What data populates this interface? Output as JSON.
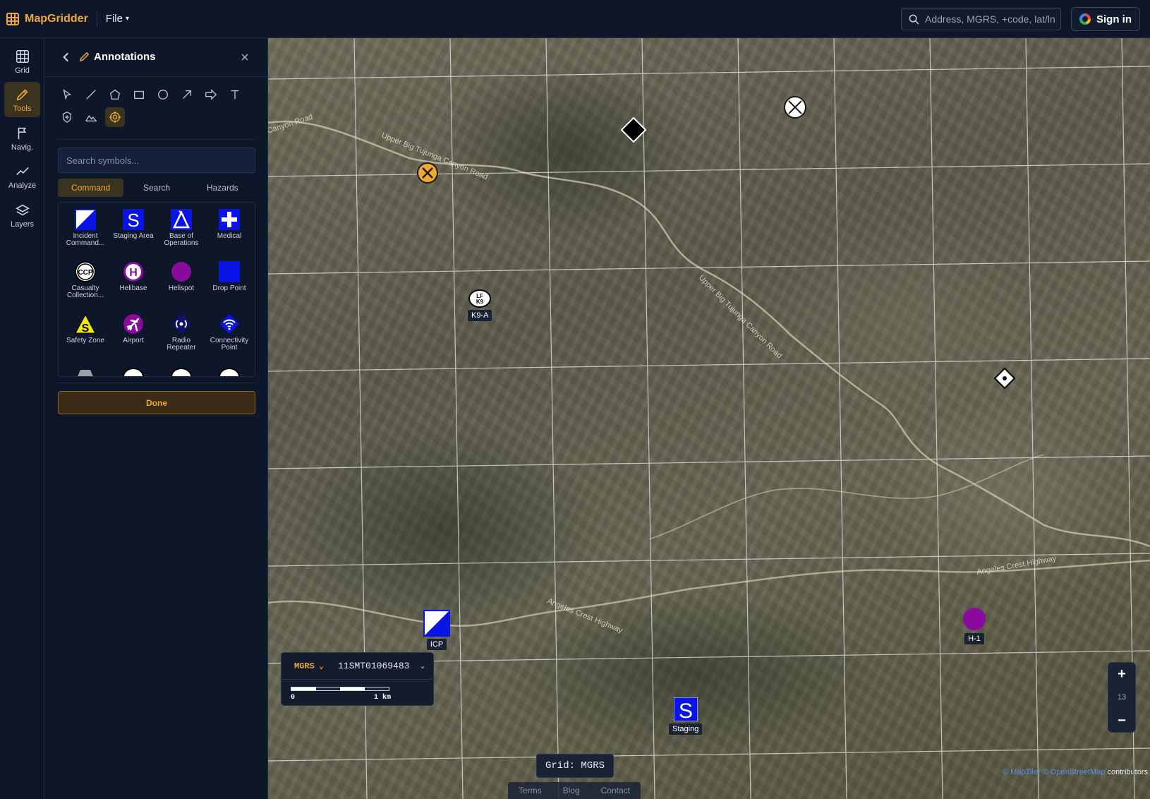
{
  "app": {
    "name": "MapGridder"
  },
  "menu": {
    "file_label": "File"
  },
  "search": {
    "placeholder": "Address, MGRS, +code, lat/ln"
  },
  "auth": {
    "signin_label": "Sign in"
  },
  "rail": {
    "items": [
      {
        "label": "Grid",
        "icon": "grid-icon",
        "active": false
      },
      {
        "label": "Tools",
        "icon": "pencil-icon",
        "active": true
      },
      {
        "label": "Navig.",
        "icon": "flag-icon",
        "active": false
      },
      {
        "label": "Analyze",
        "icon": "chart-line-icon",
        "active": false
      },
      {
        "label": "Layers",
        "icon": "layers-icon",
        "active": false
      }
    ]
  },
  "panel": {
    "title": "Annotations",
    "tools": [
      "select-icon",
      "line-icon",
      "polygon-icon",
      "rectangle-icon",
      "circle-icon",
      "arrow-icon",
      "big-arrow-icon",
      "text-icon",
      "shield-plus-icon",
      "terrain-icon",
      "symbol-target-icon"
    ],
    "active_tool": "symbol-target-icon",
    "symbol_search_placeholder": "Search symbols...",
    "categories": [
      {
        "label": "Command",
        "active": true
      },
      {
        "label": "Search",
        "active": false
      },
      {
        "label": "Hazards",
        "active": false
      }
    ],
    "symbols": [
      {
        "label": "Incident Command...",
        "icon": "incident-command-icon"
      },
      {
        "label": "Staging Area",
        "icon": "staging-area-icon"
      },
      {
        "label": "Base of Operations",
        "icon": "base-of-operations-icon"
      },
      {
        "label": "Medical",
        "icon": "medical-cross-icon"
      },
      {
        "label": "Casualty Collection...",
        "icon": "ccp-icon"
      },
      {
        "label": "Helibase",
        "icon": "helibase-icon"
      },
      {
        "label": "Helispot",
        "icon": "helispot-icon"
      },
      {
        "label": "Drop Point",
        "icon": "drop-point-icon"
      },
      {
        "label": "Safety Zone",
        "icon": "safety-zone-icon"
      },
      {
        "label": "Airport",
        "icon": "airport-icon"
      },
      {
        "label": "Radio Repeater",
        "icon": "radio-repeater-icon"
      },
      {
        "label": "Connectivity Point",
        "icon": "connectivity-icon"
      }
    ],
    "done_label": "Done"
  },
  "map": {
    "markers": {
      "k9": {
        "label": "K9-A",
        "icon_text": "LF K9"
      },
      "icp": {
        "label": "ICP"
      },
      "staging": {
        "label": "Staging",
        "icon_text": "S"
      },
      "helispot": {
        "label": "H-1"
      }
    },
    "road_labels": [
      "Upper Big Tujunga Canyon Road",
      "Angeles Crest Highway",
      "Canyon Road"
    ],
    "coord_panel": {
      "grid_system": "MGRS",
      "coordinate": "11SMT01069483",
      "scale_start": "0",
      "scale_end": "1 km"
    },
    "grid_badge": "Grid: MGRS",
    "footer_links": [
      "Terms",
      "Blog",
      "Contact"
    ],
    "zoom": {
      "level": "13",
      "plus": "+",
      "minus": "−"
    },
    "attribution": {
      "maptiler": "© MapTiler",
      "osm": "© OpenStreetMap",
      "suffix": "contributors"
    }
  },
  "colors": {
    "accent": "#f0a830",
    "command_blue": "#0a14e6",
    "helispot_purple": "#8a0a9e",
    "panel_bg": "#0e1629"
  }
}
